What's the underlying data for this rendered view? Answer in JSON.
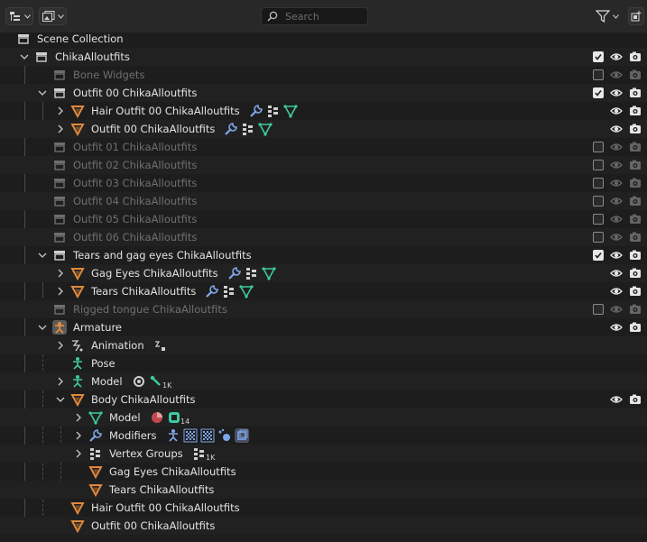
{
  "header": {
    "search_placeholder": "Search"
  },
  "tree": [
    {
      "label": "Scene Collection",
      "indent": 0,
      "icon": "scene-collection-icon",
      "disclosure": "none",
      "visibility": false
    },
    {
      "label": "ChikaAlloutfits",
      "indent": 1,
      "icon": "collection-icon",
      "disclosure": "open",
      "checkbox": true,
      "checked": true,
      "visibility": true
    },
    {
      "label": "Bone Widgets",
      "indent": 2,
      "icon": "collection-icon",
      "disclosure": "none",
      "dim": true,
      "checkbox": true,
      "checked": false,
      "visibility": true
    },
    {
      "label": "Outfit 00 ChikaAlloutfits",
      "indent": 2,
      "icon": "collection-icon",
      "disclosure": "open",
      "checkbox": true,
      "checked": true,
      "visibility": true
    },
    {
      "label": "Hair Outfit 00 ChikaAlloutfits",
      "indent": 3,
      "icon": "mesh-object-icon",
      "disclosure": "closed",
      "visibility": true,
      "extras": [
        "wrench-icon",
        "vertex-groups-icon",
        "mesh-data-icon"
      ]
    },
    {
      "label": "Outfit 00 ChikaAlloutfits",
      "indent": 3,
      "icon": "mesh-object-icon",
      "disclosure": "closed",
      "visibility": true,
      "extras": [
        "wrench-icon",
        "vertex-groups-icon",
        "mesh-data-icon"
      ]
    },
    {
      "label": "Outfit 01 ChikaAlloutfits",
      "indent": 2,
      "icon": "collection-icon",
      "disclosure": "none",
      "dim": true,
      "checkbox": true,
      "checked": false,
      "visibility": true
    },
    {
      "label": "Outfit 02 ChikaAlloutfits",
      "indent": 2,
      "icon": "collection-icon",
      "disclosure": "none",
      "dim": true,
      "checkbox": true,
      "checked": false,
      "visibility": true
    },
    {
      "label": "Outfit 03 ChikaAlloutfits",
      "indent": 2,
      "icon": "collection-icon",
      "disclosure": "none",
      "dim": true,
      "checkbox": true,
      "checked": false,
      "visibility": true
    },
    {
      "label": "Outfit 04 ChikaAlloutfits",
      "indent": 2,
      "icon": "collection-icon",
      "disclosure": "none",
      "dim": true,
      "checkbox": true,
      "checked": false,
      "visibility": true
    },
    {
      "label": "Outfit 05 ChikaAlloutfits",
      "indent": 2,
      "icon": "collection-icon",
      "disclosure": "none",
      "dim": true,
      "checkbox": true,
      "checked": false,
      "visibility": true
    },
    {
      "label": "Outfit 06 ChikaAlloutfits",
      "indent": 2,
      "icon": "collection-icon",
      "disclosure": "none",
      "dim": true,
      "checkbox": true,
      "checked": false,
      "visibility": true
    },
    {
      "label": "Tears and gag eyes ChikaAlloutfits",
      "indent": 2,
      "icon": "collection-icon",
      "disclosure": "open",
      "checkbox": true,
      "checked": true,
      "visibility": true
    },
    {
      "label": "Gag Eyes ChikaAlloutfits",
      "indent": 3,
      "icon": "mesh-object-icon",
      "disclosure": "closed",
      "visibility": true,
      "extras": [
        "wrench-icon",
        "vertex-groups-icon",
        "mesh-data-icon"
      ]
    },
    {
      "label": "Tears ChikaAlloutfits",
      "indent": 3,
      "icon": "mesh-object-icon",
      "disclosure": "closed",
      "visibility": true,
      "extras": [
        "wrench-icon",
        "vertex-groups-icon",
        "mesh-data-icon"
      ]
    },
    {
      "label": "Rigged tongue ChikaAlloutfits",
      "indent": 2,
      "icon": "collection-icon",
      "disclosure": "none",
      "dim": true,
      "checkbox": true,
      "checked": false,
      "visibility": true
    },
    {
      "label": "Armature",
      "indent": 2,
      "icon": "armature-icon",
      "disclosure": "open",
      "visibility": true
    },
    {
      "label": "Animation",
      "indent": 3,
      "icon": "animation-icon",
      "disclosure": "closed",
      "visibility": false,
      "extras": [
        "action-icon"
      ]
    },
    {
      "label": "Pose",
      "indent": 3,
      "icon": "pose-icon",
      "disclosure": "none",
      "visibility": false
    },
    {
      "label": "Model",
      "indent": 3,
      "icon": "armature-data-icon",
      "disclosure": "closed",
      "visibility": false,
      "extras": [
        "bone-settings-icon",
        "bones-icon"
      ],
      "extra_sub": "1K"
    },
    {
      "label": "Body ChikaAlloutfits",
      "indent": 3,
      "icon": "mesh-object-icon",
      "disclosure": "open",
      "visibility": true
    },
    {
      "label": "Model",
      "indent": 4,
      "icon": "mesh-data-icon",
      "disclosure": "closed",
      "visibility": false,
      "extras": [
        "material-icon",
        "shape-keys-icon"
      ],
      "extra_sub": "14"
    },
    {
      "label": "Modifiers",
      "indent": 4,
      "icon": "wrench-icon",
      "disclosure": "closed",
      "visibility": false,
      "extras": [
        "armature-modifier-icon",
        "mask-modifier-icon",
        "mask-modifier-icon",
        "particle-icon",
        "solidify-modifier-icon"
      ]
    },
    {
      "label": "Vertex Groups",
      "indent": 4,
      "icon": "vertex-groups-icon",
      "disclosure": "closed",
      "visibility": false,
      "extras": [
        "vertex-groups-icon"
      ],
      "extra_sub": "1K"
    },
    {
      "label": "Gag Eyes ChikaAlloutfits",
      "indent": 4,
      "icon": "mesh-object-icon",
      "disclosure": "none",
      "visibility": false
    },
    {
      "label": "Tears ChikaAlloutfits",
      "indent": 4,
      "icon": "mesh-object-icon",
      "disclosure": "none",
      "visibility": false
    },
    {
      "label": "Hair Outfit 00 ChikaAlloutfits",
      "indent": 3,
      "icon": "mesh-object-icon",
      "disclosure": "none",
      "visibility": false
    },
    {
      "label": "Outfit 00 ChikaAlloutfits",
      "indent": 3,
      "icon": "mesh-object-icon",
      "disclosure": "none",
      "visibility": false
    }
  ]
}
